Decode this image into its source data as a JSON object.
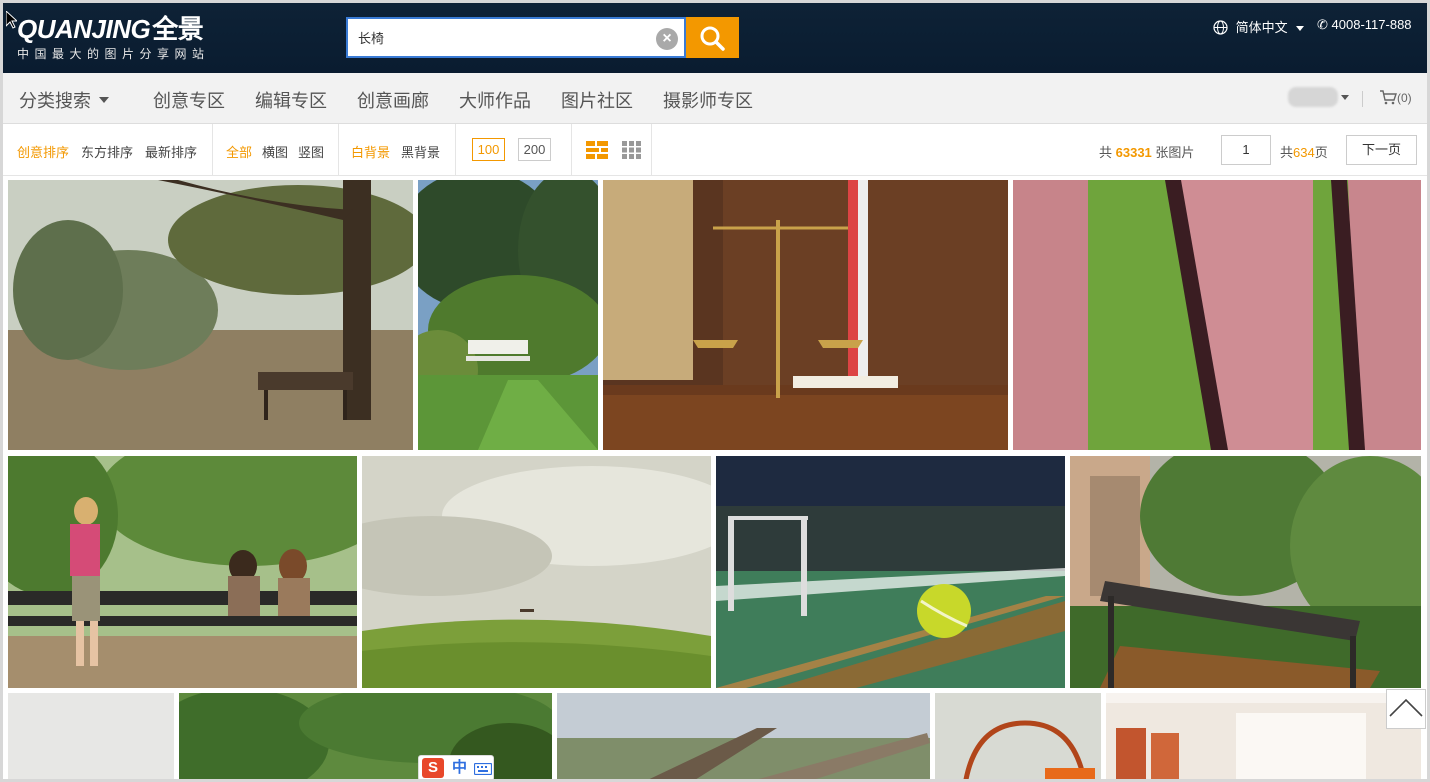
{
  "header": {
    "brand": "QUANJING",
    "brand_cn": "全景",
    "tagline": "中国最大的图片分享网站",
    "search_value": "长椅",
    "language": "简体中文",
    "phone": "4008-117-888"
  },
  "nav": {
    "category_search": "分类搜索",
    "items": [
      "创意专区",
      "编辑专区",
      "创意画廊",
      "大师作品",
      "图片社区",
      "摄影师专区"
    ],
    "cart_count": "(0)"
  },
  "filters": {
    "sort": [
      "创意排序",
      "东方排序",
      "最新排序"
    ],
    "orientation": [
      "全部",
      "横图",
      "竖图"
    ],
    "background": [
      "白背景",
      "黑背景"
    ],
    "per_page": [
      "100",
      "200"
    ],
    "total_prefix": "共",
    "total_count": "63331",
    "total_suffix": "张图片",
    "current_page": "1",
    "pages_prefix": "共",
    "pages_count": "634",
    "pages_suffix": "页",
    "next_label": "下一页"
  },
  "colors": {
    "accent": "#f39800",
    "header_bg": "#0e2236"
  },
  "photos": [
    {
      "desc": "park-bench-trees"
    },
    {
      "desc": "garden-bench-path"
    },
    {
      "desc": "scales-of-justice"
    },
    {
      "desc": "pink-bench-slats"
    },
    {
      "desc": "couple-on-bench"
    },
    {
      "desc": "grass-hill-bench"
    },
    {
      "desc": "tennis-ball-bench"
    },
    {
      "desc": "iron-bench-garden"
    },
    {
      "desc": "white-wall"
    },
    {
      "desc": "green-hedge"
    },
    {
      "desc": "wooden-benches-lake"
    },
    {
      "desc": "orange-chair"
    },
    {
      "desc": "interior-room"
    }
  ]
}
